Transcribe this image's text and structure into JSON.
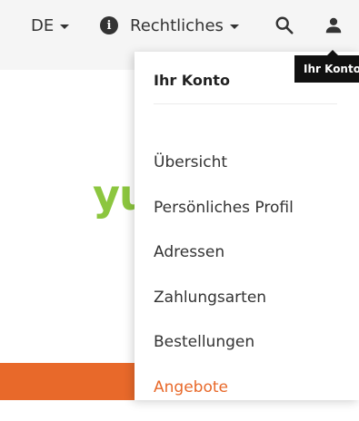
{
  "header": {
    "language_label": "DE",
    "legal_label": "Rechtliches",
    "icons": [
      "info-icon",
      "search-icon",
      "user-icon",
      "caret-down-icon"
    ]
  },
  "background": {
    "brand_fragment": "yu"
  },
  "account_menu": {
    "heading": "Ihr Konto",
    "items": [
      {
        "label": "Übersicht"
      },
      {
        "label": "Persönliches Profil"
      },
      {
        "label": "Adressen"
      },
      {
        "label": "Zahlungsarten"
      },
      {
        "label": "Bestellungen"
      },
      {
        "label": "Angebote"
      }
    ]
  },
  "tooltip": {
    "text": "Ihr Konto"
  },
  "colors": {
    "brand_green": "#8cc63f",
    "accent_orange": "#e8692a",
    "tooltip_bg": "#111111"
  }
}
